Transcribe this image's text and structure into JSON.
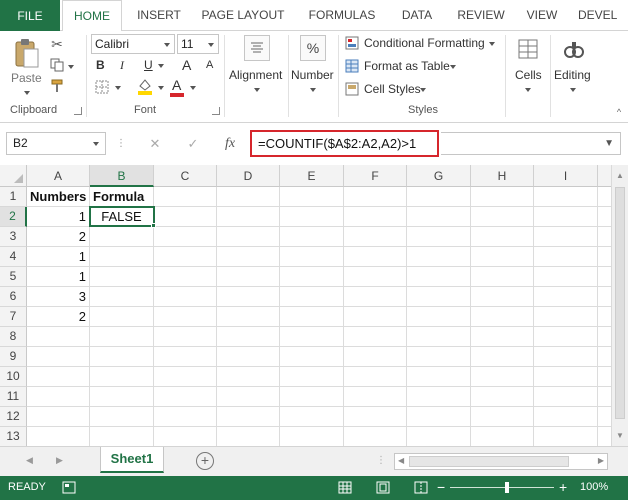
{
  "ribbon_tabs": [
    "FILE",
    "HOME",
    "INSERT",
    "PAGE LAYOUT",
    "FORMULAS",
    "DATA",
    "REVIEW",
    "VIEW",
    "DEVEL"
  ],
  "active_tab": "HOME",
  "clipboard": {
    "paste_label": "Paste",
    "group_label": "Clipboard"
  },
  "font": {
    "name": "Calibri",
    "size": "11",
    "group_label": "Font",
    "bold": "B",
    "italic": "I",
    "underline": "U",
    "grow": "A",
    "shrink": "A",
    "font_color_glyph": "A",
    "font_color": "#d6262c",
    "fill_color": "#ffd700"
  },
  "alignment": {
    "label": "Alignment"
  },
  "number": {
    "label": "Number",
    "glyph": "%"
  },
  "styles": {
    "conditional_formatting": "Conditional Formatting",
    "format_as_table": "Format as Table",
    "cell_styles": "Cell Styles",
    "group_label": "Styles"
  },
  "cells_group": {
    "label": "Cells"
  },
  "editing_group": {
    "label": "Editing"
  },
  "formula_bar": {
    "name_box": "B2",
    "cancel_glyph": "✕",
    "enter_glyph": "✓",
    "fx_glyph": "fx",
    "formula": "=COUNTIF($A$2:A2,A2)>1",
    "highlight_color": "#d6262c"
  },
  "columns": [
    "A",
    "B",
    "C",
    "D",
    "E",
    "F",
    "G",
    "H",
    "I"
  ],
  "rows": [
    "1",
    "2",
    "3",
    "4",
    "5",
    "6",
    "7",
    "8",
    "9",
    "10",
    "11",
    "12",
    "13"
  ],
  "cells": {
    "A1": "Numbers",
    "B1": "Formula",
    "A2": "1",
    "B2": "FALSE",
    "A3": "2",
    "A4": "1",
    "A5": "1",
    "A6": "3",
    "A7": "2"
  },
  "selected_cell": "B2",
  "sheet_tab": "Sheet1",
  "add_sheet_glyph": "+",
  "status": {
    "ready": "READY",
    "zoom": "100%",
    "zoom_minus": "−",
    "zoom_plus": "+"
  },
  "accent_color": "#217346",
  "icons": [
    "paste-icon",
    "cut-icon",
    "copy-icon",
    "format-painter-icon",
    "borders-icon",
    "fill-color-icon",
    "font-color-icon",
    "alignment-icon",
    "number-format-icon",
    "conditional-formatting-icon",
    "format-as-table-icon",
    "cell-styles-icon",
    "cells-icon",
    "editing-icon",
    "name-box-dropdown-icon",
    "cancel-icon",
    "enter-icon",
    "fx-icon",
    "expand-formula-icon",
    "sheet-nav-prev-icon",
    "sheet-nav-next-icon",
    "add-sheet-icon",
    "macro-record-icon",
    "normal-view-icon",
    "page-layout-view-icon",
    "page-break-view-icon"
  ]
}
